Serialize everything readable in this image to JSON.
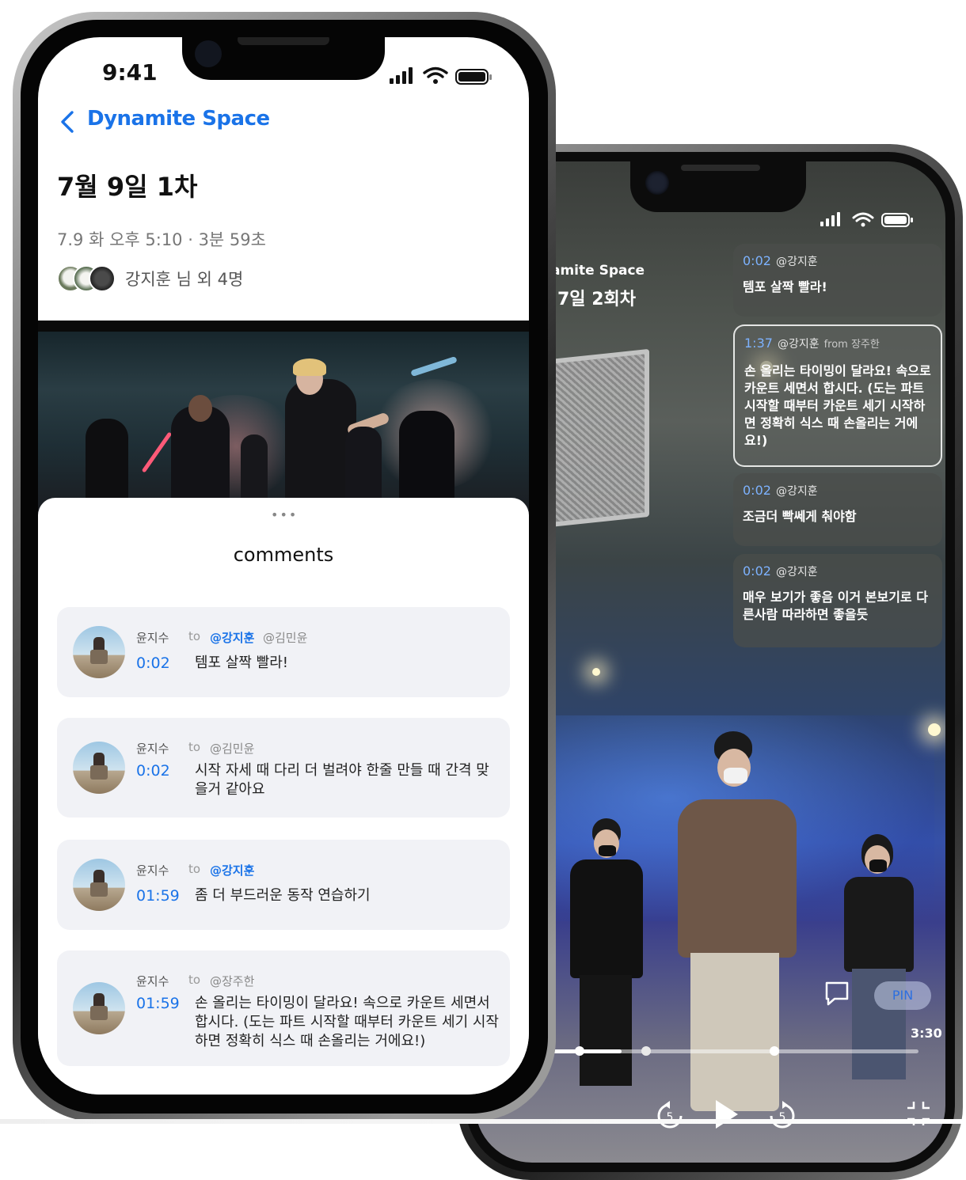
{
  "front": {
    "status": {
      "time": "9:41"
    },
    "nav": {
      "back_icon": "chevron-left-icon",
      "title": "Dynamite Space"
    },
    "page_title": "7월 9일 1차",
    "meta": "7.9 화 오후 5:10 · 3분 59초",
    "participants_label": "강지훈 님 외 4명",
    "sheet": {
      "handle": "•••",
      "title": "comments"
    },
    "comments": [
      {
        "author": "윤지수",
        "to": "to",
        "mention_main": "@강지훈",
        "mention_sub": "@김민윤",
        "time": "0:02",
        "text": "템포 살짝 빨라!"
      },
      {
        "author": "윤지수",
        "to": "to",
        "mention_main": "",
        "mention_sub": "@김민윤",
        "time": "0:02",
        "text": "시작 자세 때 다리 더 벌려야 한줄 만들 때 간격 맞을거 같아요"
      },
      {
        "author": "윤지수",
        "to": "to",
        "mention_main": "@강지훈",
        "mention_sub": "",
        "time": "01:59",
        "text": "좀 더 부드러운 동작 연습하기"
      },
      {
        "author": "윤지수",
        "to": "to",
        "mention_main": "",
        "mention_sub": "@장주한",
        "time": "01:59",
        "text": "손 올리는 타이밍이 달라요! 속으로 카운트 세면서 합시다. (도는 파트 시작할 때부터 카운트 세기 시작하면 정확히 식스 때 손올리는 거에요!)"
      }
    ]
  },
  "back": {
    "space_title_partial": "amite Space",
    "session_title_partial": "7일 2회차",
    "comments": [
      {
        "time": "0:02",
        "user": "@강지훈",
        "from": "",
        "text": "템포 살짝 빨라!"
      },
      {
        "time": "1:37",
        "user": "@강지훈",
        "from": "from 장주한",
        "text": "손 올리는 타이밍이 달라요! 속으로 카운트 세면서 합시다. (도는 파트 시작할 때부터 카운트 세기 시작하면 정확히 식스 때 손올리는 거에요!)"
      },
      {
        "time": "0:02",
        "user": "@강지훈",
        "from": "",
        "text": "조금더 빡쎄게 춰야함"
      },
      {
        "time": "0:02",
        "user": "@강지훈",
        "from": "",
        "text": "매우 보기가 좋음 이거 본보기로 다른사람 따라하면 좋을듯"
      }
    ],
    "player": {
      "pin_label": "PIN",
      "duration_label": "3:30",
      "progress": 0.33,
      "icons": [
        "comment-icon",
        "rewind-5-icon",
        "play-icon",
        "forward-5-icon",
        "exit-fullscreen-icon"
      ]
    }
  },
  "colors": {
    "accent": "#1a73e8",
    "back_accent": "#7db2ff"
  }
}
